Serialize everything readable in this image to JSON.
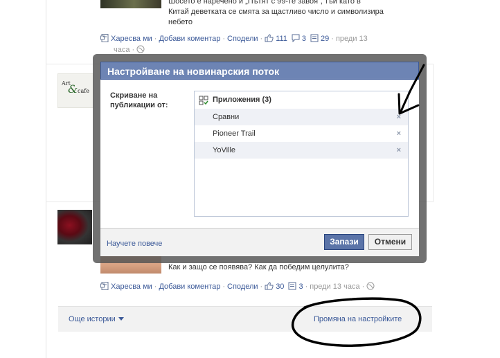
{
  "post1": {
    "text_line1": "Шосето е наречено и „Пътят с 99-те завоя“, тъй като в",
    "text_line2": "Китай деветката се смята за щастливо число и символизира",
    "text_line3": "небето",
    "like": "Харесва ми",
    "comment": "Добави коментар",
    "share": "Сподели",
    "likes_count": "111",
    "comments_count": "3",
    "shares_count": "29",
    "time": "преди 13",
    "time2": "часа"
  },
  "post2": {
    "text": "Как и защо се появява? Как да победим целулита?",
    "like": "Харесва ми",
    "comment": "Добави коментар",
    "share": "Сподели",
    "likes_count": "30",
    "shares_count": "3",
    "time": "преди 13 часа"
  },
  "stories_bar": {
    "more_stories": "Още истории",
    "change_settings": "Промяна на настройките"
  },
  "modal": {
    "title": "Настройване на новинарския поток",
    "hide_label": "Скриване на публикации от:",
    "group_title": "Приложения (3)",
    "apps": [
      {
        "name": "Сравни"
      },
      {
        "name": "Pioneer Trail"
      },
      {
        "name": "YoVille"
      }
    ],
    "remove_glyph": "×",
    "learn_more": "Научете повече",
    "save": "Запази",
    "cancel": "Отмени"
  },
  "logo": {
    "line1": "Art",
    "amp": "&",
    "line2": "cafe"
  },
  "colors": {
    "fb_blue": "#3b5998",
    "title_bar": "#6d84b4",
    "save_button": "#5b74a8"
  },
  "icons": [
    "page-icon",
    "like-icon",
    "comment-icon",
    "share-icon",
    "globe-icon",
    "apps-icon",
    "remove-icon",
    "dropdown-arrow-icon"
  ]
}
